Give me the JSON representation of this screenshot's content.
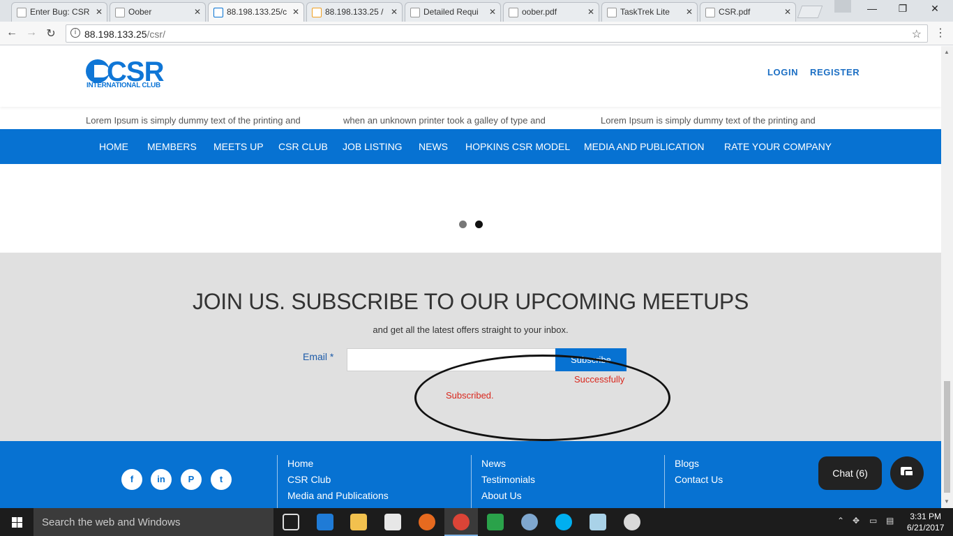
{
  "browser": {
    "tabs": [
      {
        "title": "Enter Bug: CSR"
      },
      {
        "title": "Oober"
      },
      {
        "title": "88.198.133.25/c"
      },
      {
        "title": "88.198.133.25 /"
      },
      {
        "title": "Detailed Requi"
      },
      {
        "title": "oober.pdf"
      },
      {
        "title": "TaskTrek Lite"
      },
      {
        "title": "CSR.pdf"
      }
    ],
    "url_host": "88.198.133.25",
    "url_path": "/csr/",
    "icons": {
      "back": "back-arrow-icon",
      "forward": "forward-arrow-icon",
      "reload": "reload-icon",
      "info": "info-icon",
      "bookmark": "star-icon",
      "menu": "menu-dots-icon"
    }
  },
  "header": {
    "logo_word": "CSR",
    "logo_sub": "INTERNATIONAL CLUB",
    "login": "LOGIN",
    "register": "REGISTER"
  },
  "teasers": [
    "Lorem Ipsum is simply dummy text of the printing and",
    "when an unknown printer took a galley of type and",
    "Lorem Ipsum is simply dummy text of the printing and"
  ],
  "nav": [
    "HOME",
    "MEMBERS",
    "MEETS UP",
    "CSR CLUB",
    "JOB LISTING",
    "NEWS",
    "HOPKINS CSR MODEL",
    "MEDIA AND PUBLICATION",
    "RATE YOUR COMPANY"
  ],
  "carousel": {
    "slides": 2,
    "active": 2
  },
  "subscribe": {
    "heading": "JOIN US. SUBSCRIBE TO OUR UPCOMING MEETUPS",
    "lead": "and get all the latest offers straight to your inbox.",
    "email_label": "Email",
    "required_mark": "*",
    "email_value": "",
    "button": "Subscribe",
    "message_line1": "Successfully",
    "message_line2": "Subscribed."
  },
  "footer": {
    "social": [
      {
        "label": "f",
        "icon": "facebook-icon"
      },
      {
        "label": "in",
        "icon": "linkedin-icon"
      },
      {
        "label": "P",
        "icon": "pinterest-icon"
      },
      {
        "label": "t",
        "icon": "twitter-icon"
      }
    ],
    "col1": [
      "Home",
      "CSR Club",
      "Media and Publications"
    ],
    "col2": [
      "News",
      "Testimonials",
      "About Us"
    ],
    "col3": [
      "Blogs",
      "Contact Us"
    ],
    "chat_label": "Chat (6)"
  },
  "taskbar": {
    "search_placeholder": "Search the web and Windows",
    "time": "3:31 PM",
    "date": "6/21/2017"
  },
  "colors": {
    "brand_blue": "#0772d2",
    "error_red": "#d9261c",
    "subscribe_bg": "#e0e0e0"
  }
}
